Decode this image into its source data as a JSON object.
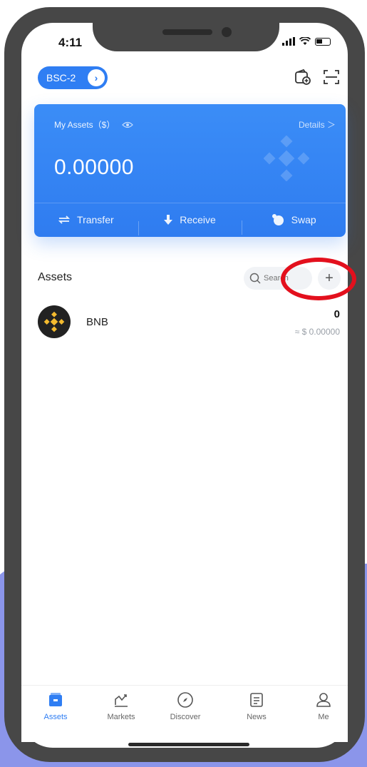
{
  "status_bar": {
    "time": "4:11"
  },
  "header": {
    "network_label": "BSC-2",
    "icons": [
      "wallet-add-icon",
      "scan-icon"
    ]
  },
  "assets_card": {
    "label": "My Assets（$）",
    "details_label": "Details ＞",
    "balance": "0.00000",
    "actions": [
      {
        "label": "Transfer",
        "icon": "transfer-icon"
      },
      {
        "label": "Receive",
        "icon": "receive-icon"
      },
      {
        "label": "Swap",
        "icon": "swap-icon"
      }
    ]
  },
  "assets_section": {
    "title": "Assets",
    "search_placeholder": "Search",
    "add_label": "+",
    "tokens": [
      {
        "name": "BNB",
        "balance": "0",
        "value": "≈ $ 0.00000"
      }
    ]
  },
  "bottom_nav": {
    "items": [
      {
        "label": "Assets",
        "icon": "wallet-icon",
        "active": true
      },
      {
        "label": "Markets",
        "icon": "chart-icon",
        "active": false
      },
      {
        "label": "Discover",
        "icon": "compass-icon",
        "active": false
      },
      {
        "label": "News",
        "icon": "news-icon",
        "active": false
      },
      {
        "label": "Me",
        "icon": "user-icon",
        "active": false
      }
    ]
  },
  "colors": {
    "accent": "#2f7ef3",
    "highlight": "#e3101d",
    "frame": "#474747",
    "background_accent": "#8b95ea",
    "bnb_yellow": "#f3ba2f"
  }
}
